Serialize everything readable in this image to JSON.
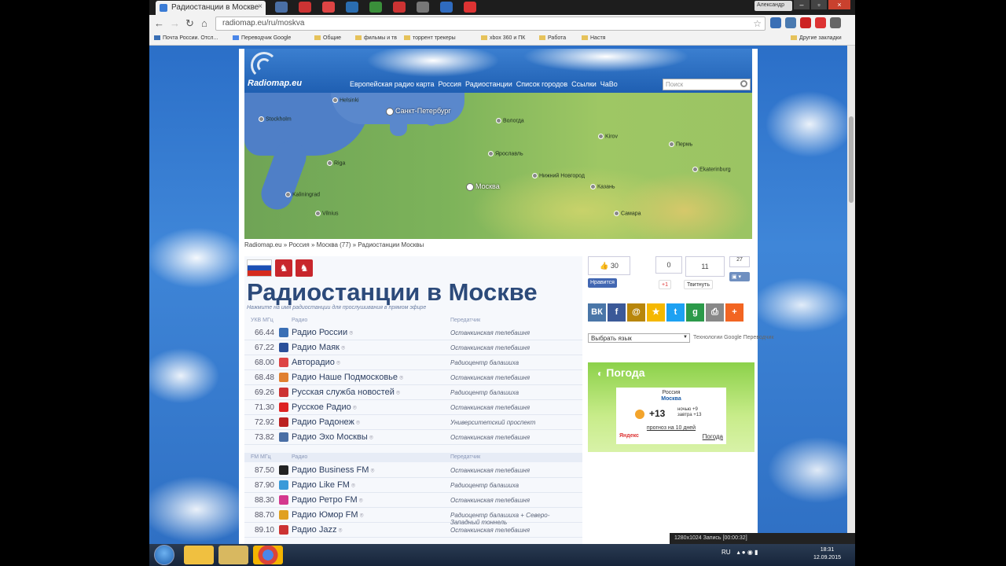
{
  "browser": {
    "tab_title": "Радиостанции в Москве",
    "url": "radiomap.eu/ru/moskva",
    "user_button": "Александр",
    "bookmarks": [
      "Почта России. Отсл...",
      "Переводчик Google",
      "Общие",
      "фильмы и тв",
      "торрент трекеры",
      "xbox 360 и ПК",
      "Работа",
      "Настя"
    ],
    "other_bookmarks": "Другие закладки"
  },
  "site": {
    "logo": "Radiomap.eu",
    "nav": [
      "Европейская радио карта",
      "Россия",
      "Радиостанции",
      "Список городов",
      "Ссылки",
      "ЧаВо"
    ],
    "search_placeholder": "Поиск",
    "breadcrumb": "Radiomap.eu » Россия » Москва (77) » Радиостанции Москвы",
    "title": "Радиостанции в Москве",
    "subtitle": "Нажмите на имя радиостанции для прослушивания в прямом эфире"
  },
  "map": {
    "cities": [
      "Helsinki",
      "Stockholm",
      "Riga",
      "Санкт-Петербург",
      "Вологда",
      "Ярославль",
      "Москва",
      "Нижний Новгород",
      "Казань",
      "Пермь",
      "Ekaterinburg",
      "Kaliningrad",
      "Vilnius",
      "Kirov",
      "Самара"
    ]
  },
  "table": {
    "ukv_header": {
      "band": "УКВ МГц",
      "radio": "Радио",
      "transmitter": "Передатчик"
    },
    "ukv_rows": [
      {
        "freq": "66.44",
        "name": "Радио России",
        "prog": "Останкинская телебашня"
      },
      {
        "freq": "67.22",
        "name": "Радио Маяк",
        "prog": "Останкинская телебашня"
      },
      {
        "freq": "68.00",
        "name": "Авторадио",
        "prog": "Радиоцентр балашиха"
      },
      {
        "freq": "68.48",
        "name": "Радио Наше Подмосковье",
        "prog": "Останкинская телебашня"
      },
      {
        "freq": "69.26",
        "name": "Русская служба новостей",
        "prog": "Радиоцентр балашиха"
      },
      {
        "freq": "71.30",
        "name": "Русское Радио",
        "prog": "Останкинская телебашня"
      },
      {
        "freq": "72.92",
        "name": "Радио Радонеж",
        "prog": "Университетский проспект"
      },
      {
        "freq": "73.82",
        "name": "Радио Эхо Москвы",
        "prog": "Останкинская телебашня"
      }
    ],
    "fm_header": {
      "band": "FM МГц",
      "radio": "Радио",
      "transmitter": "Передатчик"
    },
    "fm_rows": [
      {
        "freq": "87.50",
        "name": "Радио Business FM",
        "prog": "Останкинская телебашня"
      },
      {
        "freq": "87.90",
        "name": "Радио Like FM",
        "prog": "Радиоцентр балашиха"
      },
      {
        "freq": "88.30",
        "name": "Радио Ретро FM",
        "prog": "Останкинская телебашня"
      },
      {
        "freq": "88.70",
        "name": "Радио Юмор FM",
        "prog": "Радиоцентр балашиха + Северо-Западный тоннель"
      },
      {
        "freq": "89.10",
        "name": "Радио Jazz",
        "prog": "Останкинская телебашня"
      }
    ]
  },
  "social": {
    "like_count": "30",
    "like_label": "Нравится",
    "gplus_count": "0",
    "gplus_label": "+1",
    "tweet_count": "11",
    "tweet_label": "Твитнуть",
    "other_count": "27",
    "share_icons": [
      "ВК",
      "f",
      "@",
      "★",
      "t",
      "g",
      "⎙",
      "+"
    ]
  },
  "translate": {
    "select": "Выбрать язык",
    "powered": "Технологии Google Переводчик"
  },
  "weather": {
    "title": "Погода",
    "country": "Россия",
    "city": "Москва",
    "temp": "+13",
    "night": "ночью +9",
    "tomorrow": "завтра +13",
    "forecast": "прогноз на 10 дней",
    "brand": "Яндекс",
    "link": "Погода"
  },
  "taskbar": {
    "lang": "RU",
    "time": "18:31",
    "date": "12.09.2015",
    "recorder": "1280x1024   Запись [00:00:32]"
  },
  "colors": {
    "accent": "#2c4a7a",
    "weather_green": "#8cd14a"
  }
}
